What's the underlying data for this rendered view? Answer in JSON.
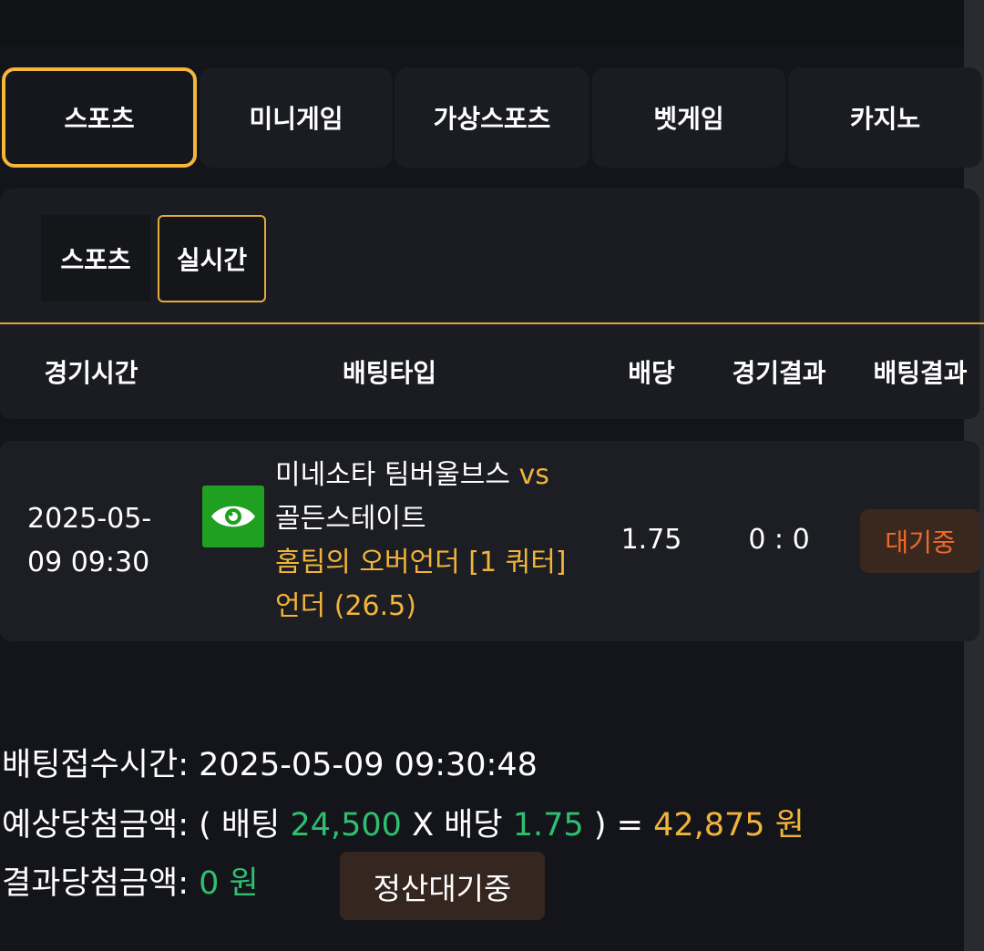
{
  "colors": {
    "background": "#14151a",
    "panel": "#1b1c21",
    "accent_gold": "#f1b43b",
    "active_border": "#f4b73a",
    "eye_green": "#20a020",
    "value_green": "#2fbf71",
    "status_orange": "#ef6a2a",
    "status_bg": "#3a281f"
  },
  "main_tabs": [
    {
      "label": "스포츠",
      "active": true
    },
    {
      "label": "미니게임",
      "active": false
    },
    {
      "label": "가상스포츠",
      "active": false
    },
    {
      "label": "벳게임",
      "active": false
    },
    {
      "label": "카지노",
      "active": false
    }
  ],
  "sub_tabs": [
    {
      "label": "스포츠",
      "active": false
    },
    {
      "label": "실시간",
      "active": true
    }
  ],
  "table": {
    "headers": {
      "time": "경기시간",
      "bet_type": "배팅타입",
      "odds": "배당",
      "game_result": "경기결과",
      "bet_result": "배팅결과"
    },
    "rows": [
      {
        "time_line1": "2025-05-",
        "time_line2": "09 09:30",
        "icon": "eye-icon",
        "home_team": "미네소타 팀버울브스",
        "vs": "vs",
        "away_team": "골든스테이트",
        "market": "홈팀의 오버언더 [1 쿼터]",
        "pick": "언더 (26.5)",
        "odds": "1.75",
        "score": "0 : 0",
        "status": "대기중"
      }
    ]
  },
  "summary": {
    "time_label": "배팅접수시간:",
    "time_value": "2025-05-09 09:30:48",
    "expected_label": "예상당첨금액:",
    "open_paren": "( 배팅",
    "bet_amount": "24,500",
    "times_label": "X 배당",
    "odds": "1.75",
    "close_paren": ") =",
    "expected_amount": "42,875 원",
    "result_label": "결과당첨금액:",
    "result_amount": "0 원",
    "settle_button": "정산대기중"
  }
}
